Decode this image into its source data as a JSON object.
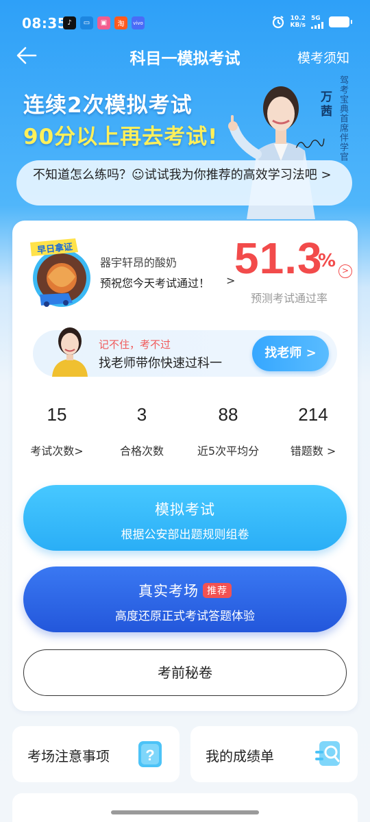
{
  "status_bar": {
    "time": "08:35",
    "net_speed_value": "10.2",
    "net_speed_unit": "KB/s",
    "network": "5G"
  },
  "header": {
    "title": "科目一模拟考试",
    "notice_link": "模考须知"
  },
  "banner": {
    "line1": "连续2次模拟考试",
    "line2": "90分以上再去考试!",
    "coach_name": "万茜",
    "coach_title": "驾考宝典首席伴学官",
    "tip": "不知道怎么练吗？☺试试我为你推荐的高效学习法吧 >"
  },
  "profile": {
    "badge_text": "早日拿证",
    "username": "器宇轩昂的酸奶",
    "wish": "预祝您今天考试通过！",
    "pass_rate_value": "51.3",
    "pass_rate_unit": "%",
    "pass_rate_label": "预测考试通过率"
  },
  "teacher": {
    "tip": "记不住，考不过",
    "desc": "找老师带你快速过科一",
    "button": "找老师 >"
  },
  "stats": [
    {
      "value": "15",
      "label": "考试次数>"
    },
    {
      "value": "3",
      "label": "合格次数"
    },
    {
      "value": "88",
      "label": "近5次平均分"
    },
    {
      "value": "214",
      "label": "错题数 >"
    }
  ],
  "buttons": {
    "mock_title": "模拟考试",
    "mock_sub": "根据公安部出题规则组卷",
    "real_title": "真实考场",
    "real_tag": "推荐",
    "real_sub": "高度还原正式考试答题体验",
    "secret": "考前秘卷"
  },
  "bottom": {
    "notes": "考场注意事项",
    "scores": "我的成绩单"
  },
  "colors": {
    "primary": "#2ea0f8",
    "accent_red": "#f24b4b",
    "highlight_yellow": "#fff05a",
    "real_exam_blue": "#2357db"
  }
}
